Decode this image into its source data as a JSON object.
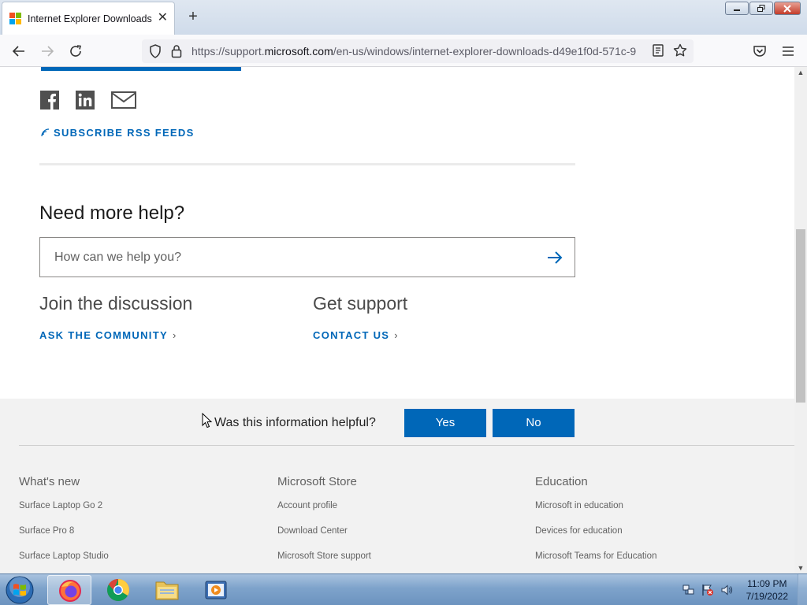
{
  "browser": {
    "tab_title": "Internet Explorer Downloads",
    "tab_close": "✕",
    "new_tab": "+",
    "url_prefix": "https://support.",
    "url_domain": "microsoft.com",
    "url_path": "/en-us/windows/internet-explorer-downloads-d49e1f0d-571c-9"
  },
  "share": {
    "icons": [
      "facebook-icon",
      "linkedin-icon",
      "email-icon"
    ],
    "rss_label": "SUBSCRIBE RSS FEEDS"
  },
  "help": {
    "heading": "Need more help?",
    "search_placeholder": "How can we help you?",
    "join_heading": "Join the discussion",
    "join_link": "ASK THE COMMUNITY",
    "support_heading": "Get support",
    "support_link": "CONTACT US",
    "chevron": "›"
  },
  "feedback": {
    "question": "Was this information helpful?",
    "yes": "Yes",
    "no": "No"
  },
  "footer": {
    "columns": [
      {
        "heading": "What's new",
        "links": [
          "Surface Laptop Go 2",
          "Surface Pro 8",
          "Surface Laptop Studio"
        ]
      },
      {
        "heading": "Microsoft Store",
        "links": [
          "Account profile",
          "Download Center",
          "Microsoft Store support"
        ]
      },
      {
        "heading": "Education",
        "links": [
          "Microsoft in education",
          "Devices for education",
          "Microsoft Teams for Education"
        ]
      }
    ]
  },
  "taskbar": {
    "apps": [
      "firefox-icon",
      "chrome-icon",
      "file-explorer-icon",
      "media-player-icon"
    ],
    "time": "11:09 PM",
    "date": "7/19/2022"
  },
  "colors": {
    "accent": "#0067b8",
    "feedback_bg": "#f2f2f2"
  }
}
